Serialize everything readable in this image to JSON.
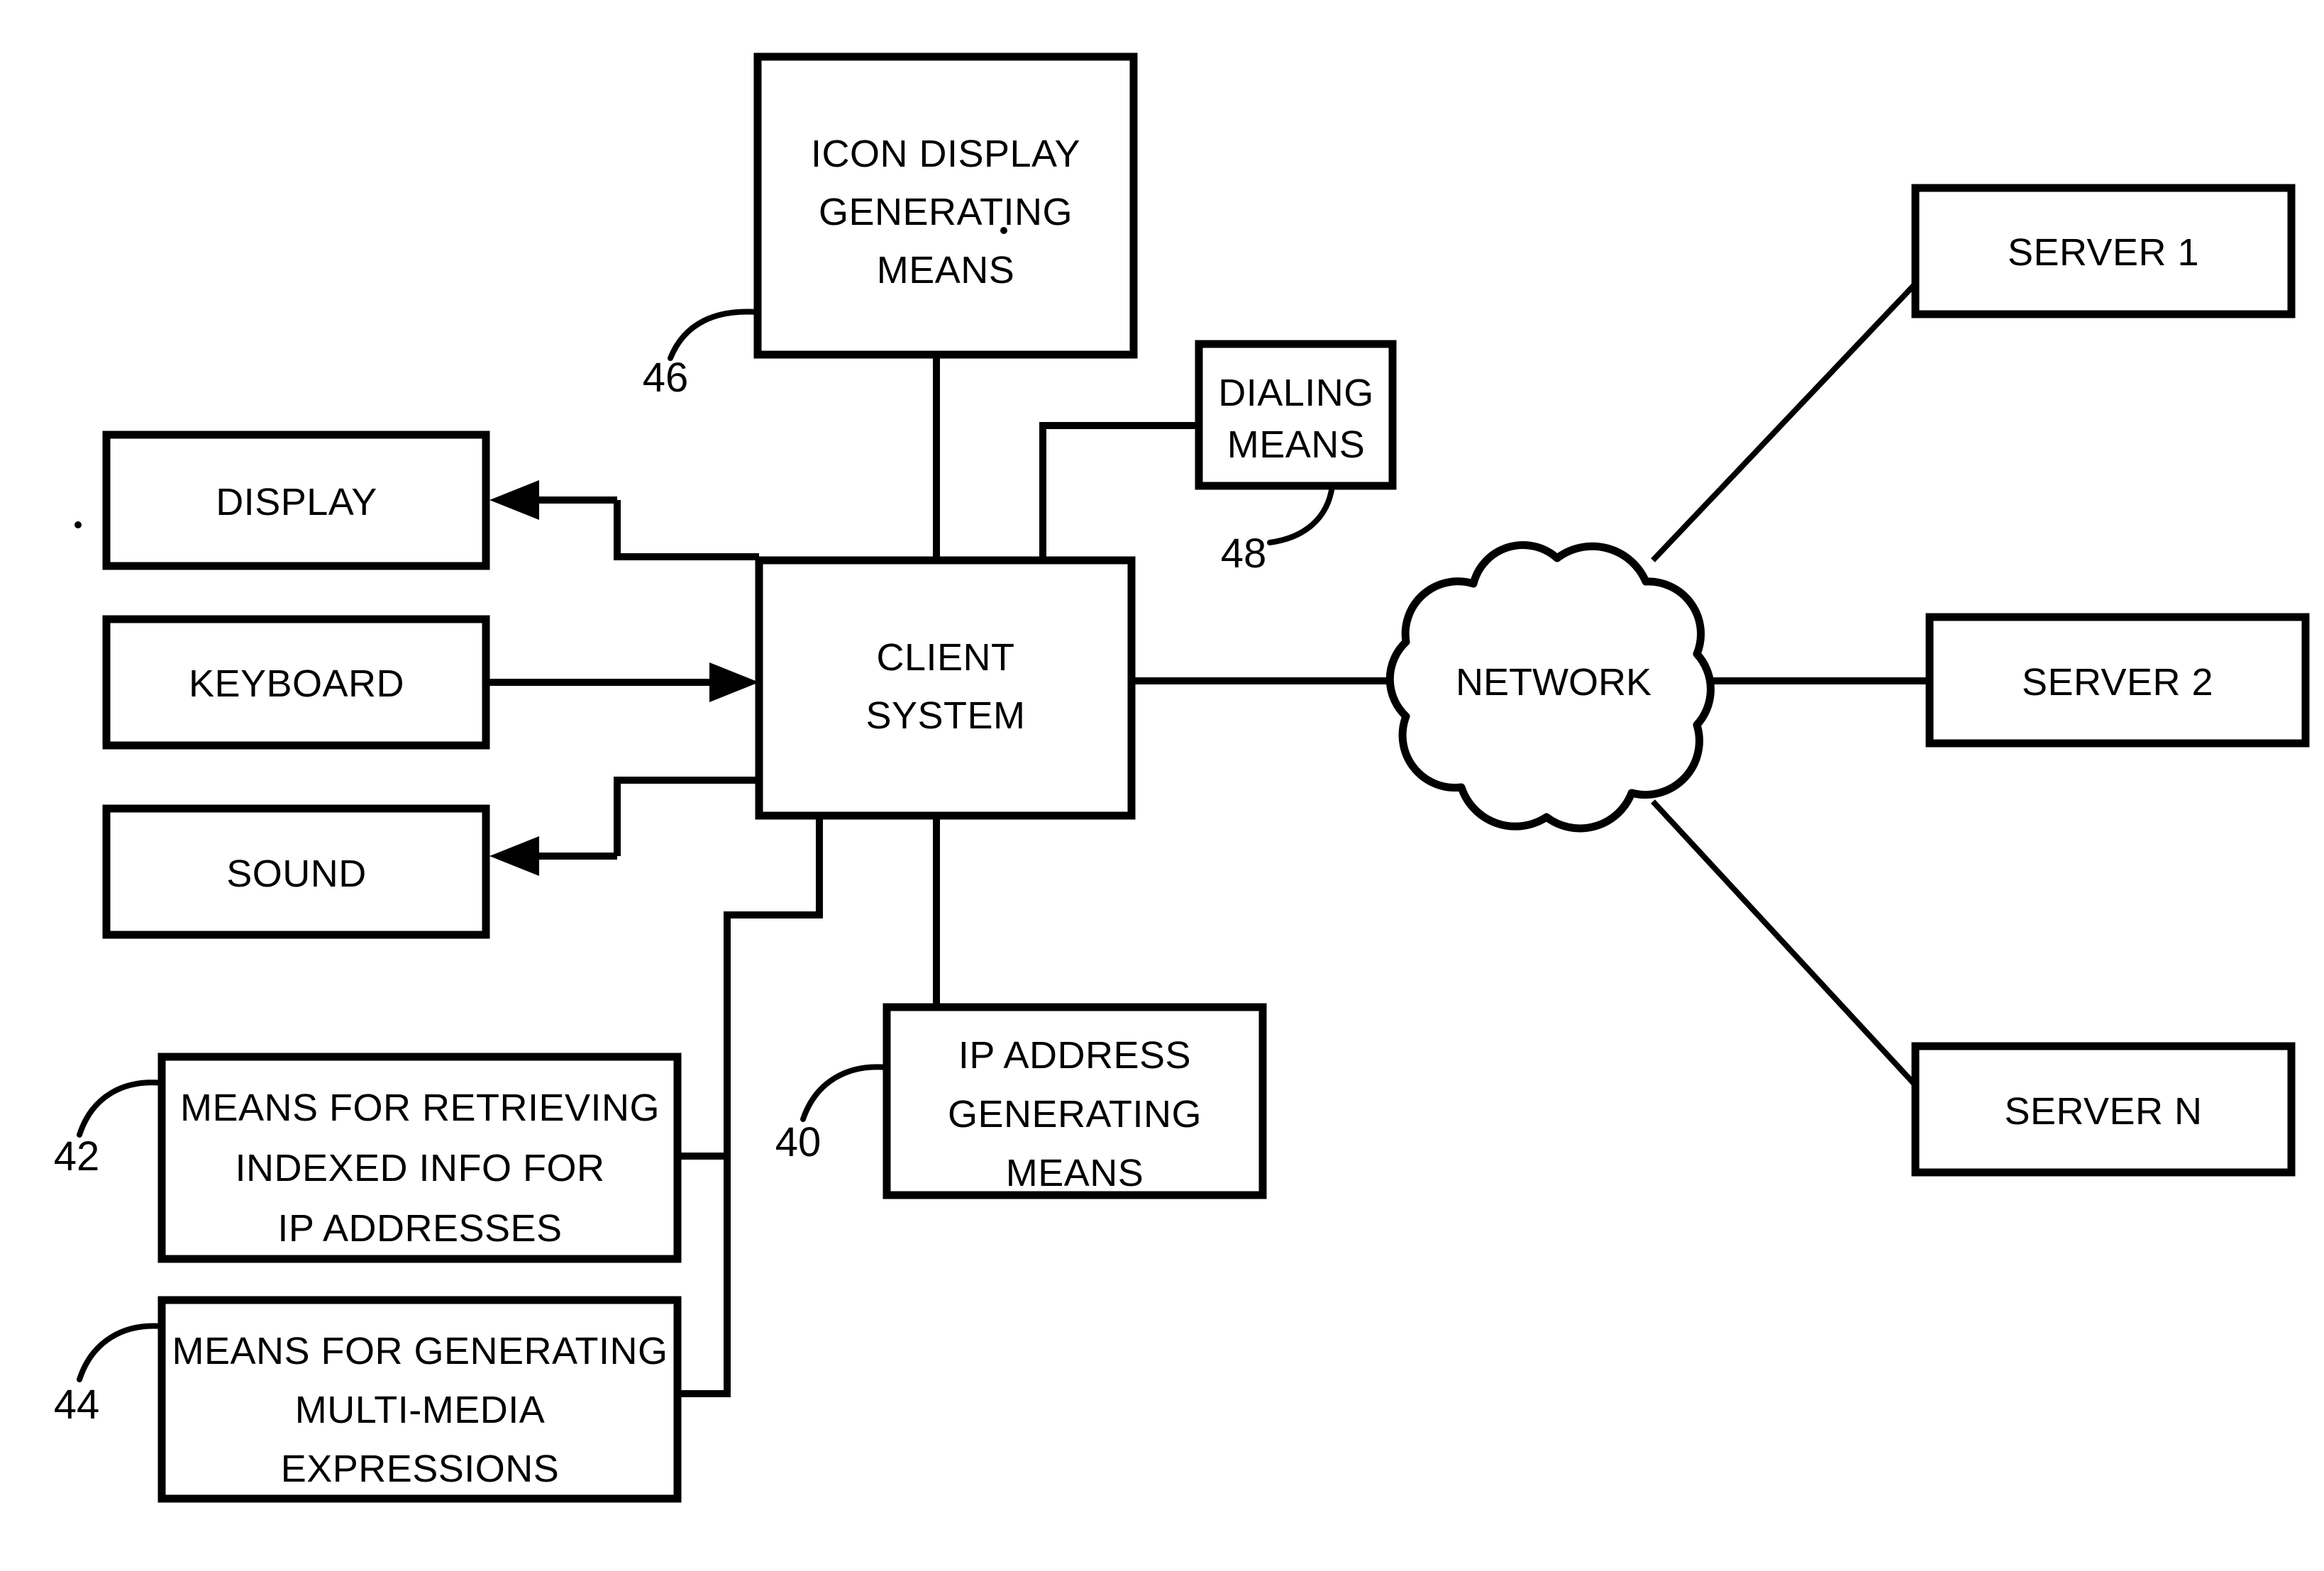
{
  "figure": {
    "type": "patent-block-diagram",
    "background_color": "#ffffff",
    "line_color": "#000000"
  },
  "blocks": {
    "icon_display": {
      "label_line1": "ICON DISPLAY",
      "label_line2": "GENERATING",
      "label_line3": "MEANS",
      "ref": "46"
    },
    "dialing": {
      "label_line1": "DIALING",
      "label_line2": "MEANS",
      "ref": "48"
    },
    "client_system": {
      "label_line1": "CLIENT",
      "label_line2": "SYSTEM"
    },
    "display": {
      "label": "DISPLAY"
    },
    "keyboard": {
      "label": "KEYBOARD"
    },
    "sound": {
      "label": "SOUND"
    },
    "retrieving_indexed": {
      "label_line1": "MEANS FOR RETRIEVING",
      "label_line2": "INDEXED INFO FOR",
      "label_line3": "IP ADDRESSES",
      "ref": "42"
    },
    "multimedia": {
      "label_line1": "MEANS FOR GENERATING",
      "label_line2": "MULTI-MEDIA",
      "label_line3": "EXPRESSIONS",
      "ref": "44"
    },
    "ip_address": {
      "label_line1": "IP ADDRESS",
      "label_line2": "GENERATING",
      "label_line3": "MEANS",
      "ref": "40"
    },
    "network": {
      "label": "NETWORK"
    },
    "server1": {
      "label": "SERVER 1"
    },
    "server2": {
      "label": "SERVER 2"
    },
    "servern": {
      "label": "SERVER N"
    }
  },
  "reference_numerals": [
    "40",
    "42",
    "44",
    "46",
    "48"
  ],
  "connections": [
    {
      "from": "icon_display",
      "to": "client_system",
      "style": "line"
    },
    {
      "from": "dialing",
      "to": "client_system",
      "style": "line"
    },
    {
      "from": "client_system",
      "to": "display",
      "style": "arrow"
    },
    {
      "from": "keyboard",
      "to": "client_system",
      "style": "arrow"
    },
    {
      "from": "client_system",
      "to": "sound",
      "style": "arrow"
    },
    {
      "from": "client_system",
      "to": "retrieving_indexed",
      "style": "line"
    },
    {
      "from": "client_system",
      "to": "multimedia",
      "style": "line"
    },
    {
      "from": "client_system",
      "to": "ip_address",
      "style": "line"
    },
    {
      "from": "client_system",
      "to": "network",
      "style": "line"
    },
    {
      "from": "network",
      "to": "server1",
      "style": "line"
    },
    {
      "from": "network",
      "to": "server2",
      "style": "line"
    },
    {
      "from": "network",
      "to": "servern",
      "style": "line"
    }
  ]
}
